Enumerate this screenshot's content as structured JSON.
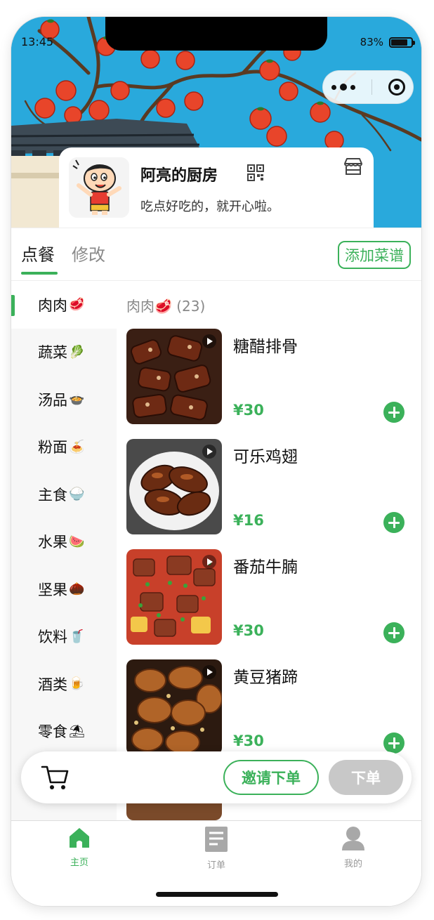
{
  "status_bar": {
    "time": "13:45",
    "battery": "83%",
    "battery_level": 0.83
  },
  "mini_program_capsule": {
    "menu_icon": "more-dots-icon",
    "close_icon": "target-circle-icon"
  },
  "shop": {
    "name": "阿亮的厨房",
    "description": "吃点好吃的，就开心啦。",
    "qr_icon": "qr-code-icon",
    "store_icon": "storefront-icon"
  },
  "tabs": {
    "order": "点餐",
    "edit": "修改",
    "add_recipe": "添加菜谱"
  },
  "categories": [
    {
      "name": "肉肉",
      "emoji": "🥩",
      "active": true
    },
    {
      "name": "蔬菜",
      "emoji": "🥬"
    },
    {
      "name": "汤品",
      "emoji": "🍲"
    },
    {
      "name": "粉面",
      "emoji": "🍝"
    },
    {
      "name": "主食",
      "emoji": "🍚"
    },
    {
      "name": "水果",
      "emoji": "🍉"
    },
    {
      "name": "坚果",
      "emoji": "🌰"
    },
    {
      "name": "饮料",
      "emoji": "🥤"
    },
    {
      "name": "酒类",
      "emoji": "🍺"
    },
    {
      "name": "零食",
      "emoji": "⛱"
    }
  ],
  "dish_list": {
    "header": "肉肉🥩 (23)",
    "dishes": [
      {
        "name": "糖醋排骨",
        "price": "¥30"
      },
      {
        "name": "可乐鸡翅",
        "price": "¥16"
      },
      {
        "name": "番茄牛腩",
        "price": "¥30"
      },
      {
        "name": "黄豆猪蹄",
        "price": "¥30"
      }
    ]
  },
  "cart_bar": {
    "cart_icon": "shopping-cart-icon",
    "invite": "邀请下单",
    "submit": "下单"
  },
  "tabbar": {
    "home": "主页",
    "orders": "订单",
    "mine": "我的"
  }
}
